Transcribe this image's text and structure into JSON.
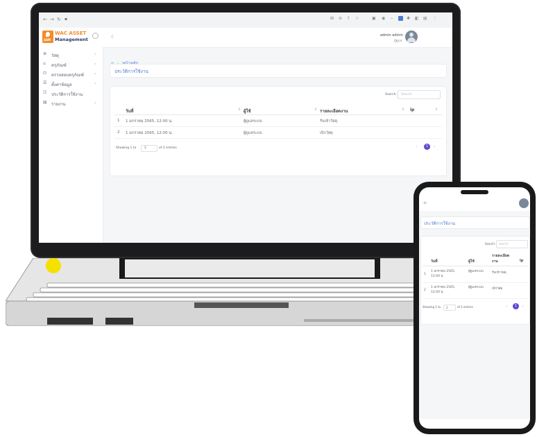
{
  "browser": {
    "nav_icons": [
      "back-icon",
      "forward-icon",
      "reload-icon",
      "secure-icon"
    ]
  },
  "brand": {
    "badge": "ASM",
    "name_line1": "WAC ASSET",
    "name_line2": "Management"
  },
  "user": {
    "name": "admin admin",
    "role": "ผู้ดูแล"
  },
  "sidebar": {
    "items": [
      {
        "label": "วัสดุ",
        "icon": "box-icon",
        "has_children": true
      },
      {
        "label": "ครุภัณฑ์",
        "icon": "cabinet-icon",
        "has_children": true
      },
      {
        "label": "ตรวจสอบครุภัณฑ์",
        "icon": "check-icon",
        "has_children": true
      },
      {
        "label": "ตั้งค่าข้อมูล",
        "icon": "settings-icon",
        "has_children": true
      },
      {
        "label": "ประวัติการใช้งาน",
        "icon": "history-icon",
        "has_children": false
      },
      {
        "label": "รายงาน",
        "icon": "report-icon",
        "has_children": true
      }
    ]
  },
  "breadcrumb": {
    "home": "หน้าหลัก"
  },
  "page": {
    "title": "ประวัติการใช้งาน"
  },
  "table": {
    "search_label": "Search:",
    "search_placeholder": "Search",
    "columns": [
      "วันที่",
      "ผู้ใช้",
      "รายละเอียดงาน",
      "ip"
    ],
    "rows": [
      {
        "no": "1",
        "date": "1 มกราคม 2565, 12:00 น.",
        "user": "ผู้ดูแลระบบ",
        "detail": "รับเข้าวัสดุ",
        "ip": ""
      },
      {
        "no": "2",
        "date": "1 มกราคม 2565, 12:00 น.",
        "user": "ผู้ดูแลระบบ",
        "detail": "เบิกวัสดุ",
        "ip": ""
      }
    ],
    "info": "Showing 1 to",
    "info_suffix": "of 2 entries",
    "page_size": "2",
    "current_page": "1"
  },
  "phone": {
    "page_title": "ประวัติการใช้งาน",
    "search_label": "Search:",
    "search_placeholder": "Search",
    "columns": [
      "วันที่",
      "ผู้ใช้",
      "รายละเอียดงาน",
      "ip"
    ],
    "rows": [
      {
        "no": "1",
        "date": "1 มกราคม 2565, 12:00 น.",
        "user": "ผู้ดูแลระบบ",
        "detail": "รับเข้าวัสดุ"
      },
      {
        "no": "2",
        "date": "1 มกราคม 2565, 12:00 น.",
        "user": "ผู้ดูแลระบบ",
        "detail": "เบิกวัสดุ"
      }
    ],
    "info": "Showing 1 to",
    "page_size": "2",
    "info_suffix": "of 2 entries",
    "current_page": "1"
  },
  "colors": {
    "accent": "#5b4bd1",
    "brand_orange": "#f28c28",
    "link_blue": "#4a7bd0"
  }
}
